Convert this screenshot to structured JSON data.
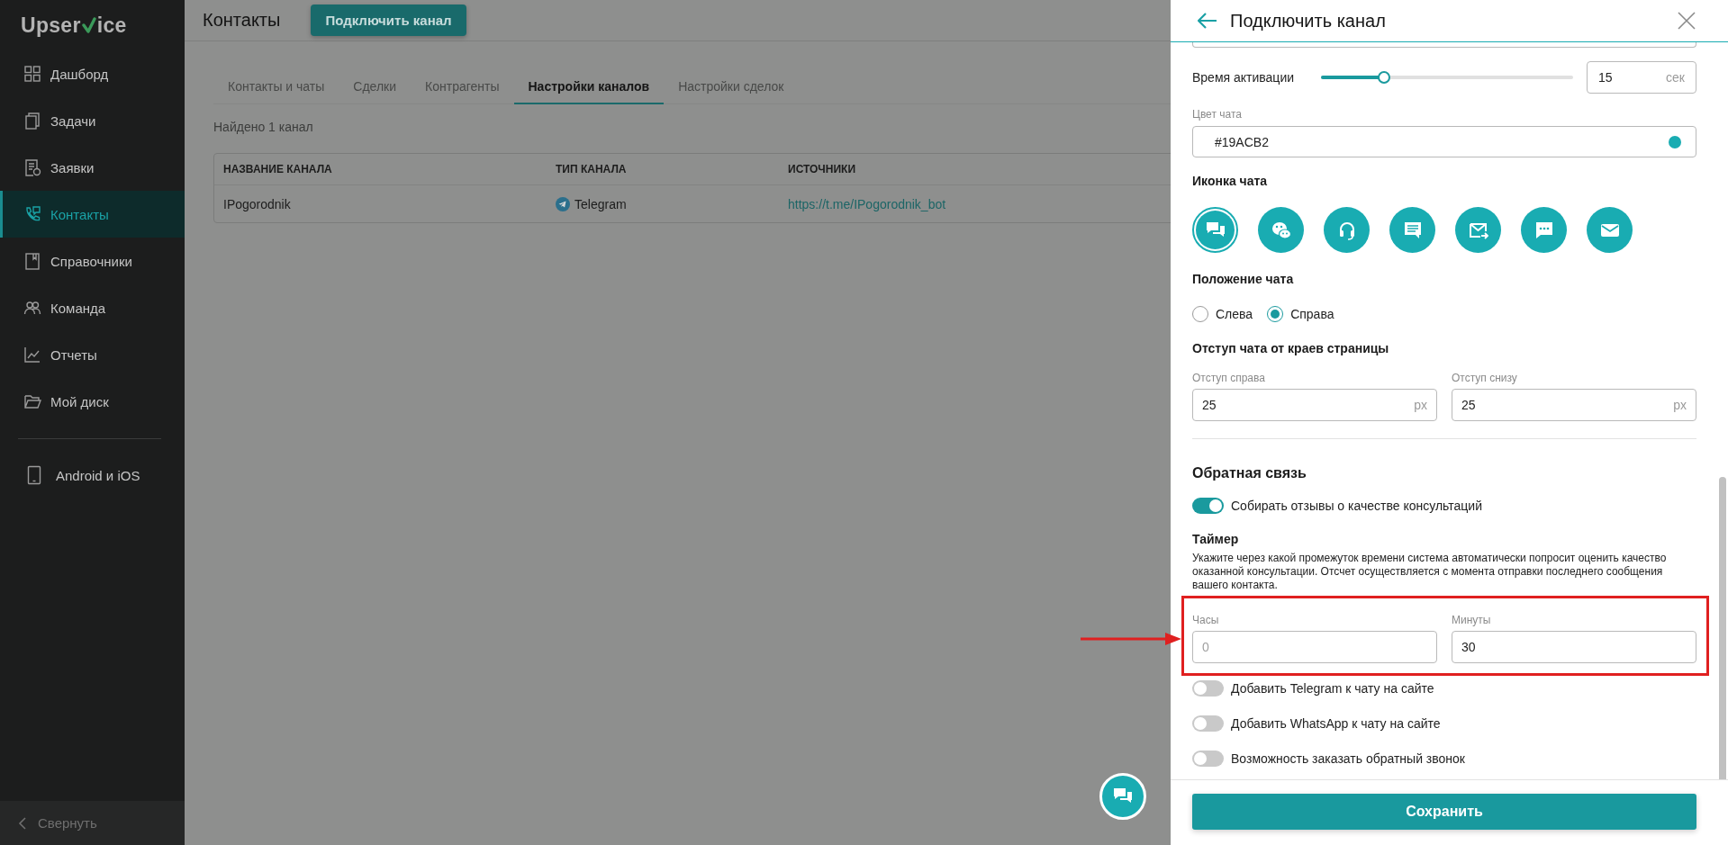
{
  "sidebar": {
    "logo": {
      "before_mark": "Upser",
      "after_mark": "ice"
    },
    "items": [
      {
        "label": "Дашборд",
        "selected": false
      },
      {
        "label": "Задачи",
        "selected": false
      },
      {
        "label": "Заявки",
        "selected": false
      },
      {
        "label": "Контакты",
        "selected": true
      },
      {
        "label": "Справочники",
        "selected": false
      },
      {
        "label": "Команда",
        "selected": false
      },
      {
        "label": "Отчеты",
        "selected": false
      },
      {
        "label": "Мой диск",
        "selected": false
      }
    ],
    "mobile_item": {
      "label": "Android и iOS"
    },
    "collapse": {
      "label": "Свернуть"
    }
  },
  "page": {
    "title": "Контакты",
    "connect_button": "Подключить канал",
    "tabs": [
      {
        "label": "Контакты и чаты",
        "selected": false
      },
      {
        "label": "Сделки",
        "selected": false
      },
      {
        "label": "Контрагенты",
        "selected": false
      },
      {
        "label": "Настройки каналов",
        "selected": true
      },
      {
        "label": "Настройки сделок",
        "selected": false
      }
    ],
    "found_text": "Найдено 1 канал",
    "table": {
      "columns": [
        "НАЗВАНИЕ КАНАЛА",
        "ТИП КАНАЛА",
        "ИСТОЧНИКИ"
      ],
      "rows": [
        {
          "name": "IPogorodnik",
          "type": "Telegram",
          "source": "https://t.me/IPogorodnik_bot"
        }
      ]
    }
  },
  "drawer": {
    "title": "Подключить канал",
    "activation": {
      "label": "Время активации",
      "level": 0.25,
      "value": "15",
      "unit": "сек"
    },
    "chat_color": {
      "label": "Цвет чата",
      "value": "#19ACB2",
      "color": "#19acb2"
    },
    "chat_icon": {
      "label": "Иконка чата",
      "options": [
        {
          "selected": true
        },
        {
          "selected": false
        },
        {
          "selected": false
        },
        {
          "selected": false
        },
        {
          "selected": false
        },
        {
          "selected": false
        },
        {
          "selected": false
        }
      ]
    },
    "position": {
      "label": "Положение чата",
      "options": [
        {
          "label": "Слева",
          "selected": false
        },
        {
          "label": "Справа",
          "selected": true
        }
      ]
    },
    "offsets": {
      "label": "Отступ чата от краев страницы",
      "fields": [
        {
          "label": "Отступ справа",
          "value": "25",
          "unit": "px"
        },
        {
          "label": "Отступ снизу",
          "value": "25",
          "unit": "px"
        }
      ]
    },
    "feedback": {
      "title": "Обратная связь",
      "toggle": {
        "label": "Собирать отзывы о качестве консультаций",
        "on": true
      },
      "timer_title": "Таймер",
      "timer_text": "Укажите через какой промежуток времени система автоматически попросит оценить качество оказанной консультации. Отсчет осуществляется с момента отправки последнего сообщения вашего контакта.",
      "fields": [
        {
          "label": "Часы",
          "placeholder": "0"
        },
        {
          "label": "Минуты",
          "value": "30"
        }
      ]
    },
    "toggles": [
      {
        "label": "Добавить Telegram к чату на сайте",
        "on": false
      },
      {
        "label": "Добавить WhatsApp к чату на сайте",
        "on": false
      },
      {
        "label": "Возможность заказать обратный звонок",
        "on": false
      }
    ],
    "save_button": "Сохранить"
  }
}
